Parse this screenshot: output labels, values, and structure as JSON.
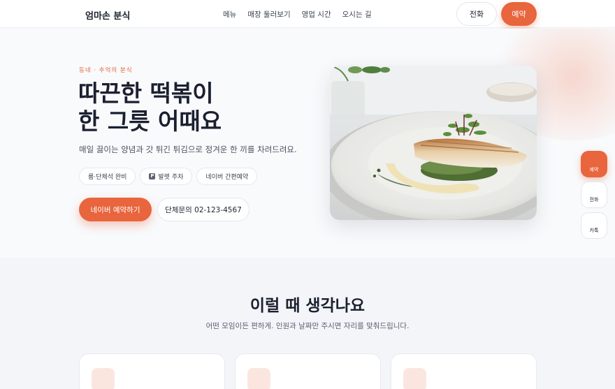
{
  "header": {
    "brand": "엄마손 분식",
    "nav": [
      "메뉴",
      "매장 둘러보기",
      "영업 시간",
      "오시는 길"
    ],
    "call_label": "전화",
    "reserve_label": "예약"
  },
  "hero": {
    "eyebrow": "동네 · 추억의 분식",
    "title_line1": "따끈한 떡볶이",
    "title_line2": "한 그릇 어때요",
    "lead": "매일 끓이는 양념과 갓 튀긴 튀김으로 정겨운 한 끼를 차려드려요.",
    "chips": [
      "룸·단체석 완비",
      "발렛 주차",
      "네이버 간편예약"
    ],
    "parking_glyph": "P",
    "naver_button": "네이버 예약하기",
    "group_button": "단체문의 02-123-4567"
  },
  "fabs": {
    "reserve": "예약",
    "call": "전화",
    "kakao": "카톡"
  },
  "section2": {
    "title": "이럴 때 생각나요",
    "subtitle": "어떤 모임이든 편하게. 인원과 날짜만 주시면 자리를 맞춰드립니다."
  },
  "colors": {
    "accent": "#e8653d",
    "text": "#1b2030",
    "muted": "#4a5060"
  },
  "icons": [
    "parking-icon",
    "food-photo"
  ]
}
